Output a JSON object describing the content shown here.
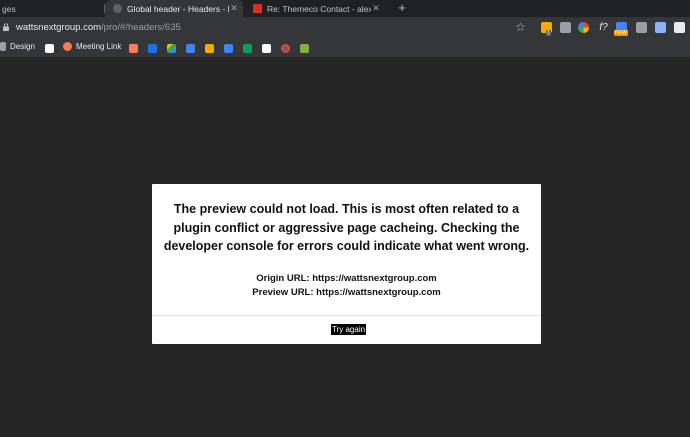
{
  "browser": {
    "tabs": [
      {
        "title": "ges",
        "active": false
      },
      {
        "title": "Global header - Headers - Pro",
        "active": true
      },
      {
        "title": "Re: Themeco Contact - alex@al",
        "active": false
      }
    ],
    "new_tab_label": "+",
    "address": {
      "host": "wattsnextgroup.com",
      "path": "/pro/#/headers/635"
    },
    "bookmarks": [
      {
        "label": "Design",
        "icon": "folder-icon"
      },
      {
        "label": "",
        "icon": "blank-page-icon"
      },
      {
        "label": "Meeting Link",
        "icon": "hubspot-icon"
      }
    ],
    "extension_badges": {
      "badge1": "1",
      "badge2": "NEW"
    }
  },
  "dialog": {
    "message": "The preview could not load. This is most often related to a plugin conflict or aggressive page cacheing. Checking the developer console for errors could indicate what went wrong.",
    "origin_url": "Origin URL: https://wattsnextgroup.com",
    "preview_url": "Preview URL: https://wattsnextgroup.com",
    "button_label": "Try again"
  },
  "colors": {
    "background": "#262626",
    "chrome_dark": "#202124",
    "chrome_bar": "#35363a",
    "dialog_bg": "#ffffff",
    "button_bg": "#000000"
  }
}
